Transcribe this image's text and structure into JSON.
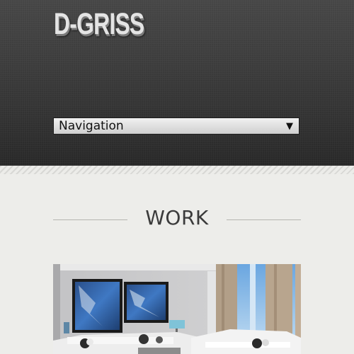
{
  "header": {
    "logo_text": "D-GRISS"
  },
  "navigation": {
    "selected": "Navigation",
    "arrow_icon": "caret-down-icon"
  },
  "section": {
    "title": "WORK"
  },
  "colors": {
    "header_bg": "#3a3a3a",
    "page_bg": "#ededea"
  }
}
